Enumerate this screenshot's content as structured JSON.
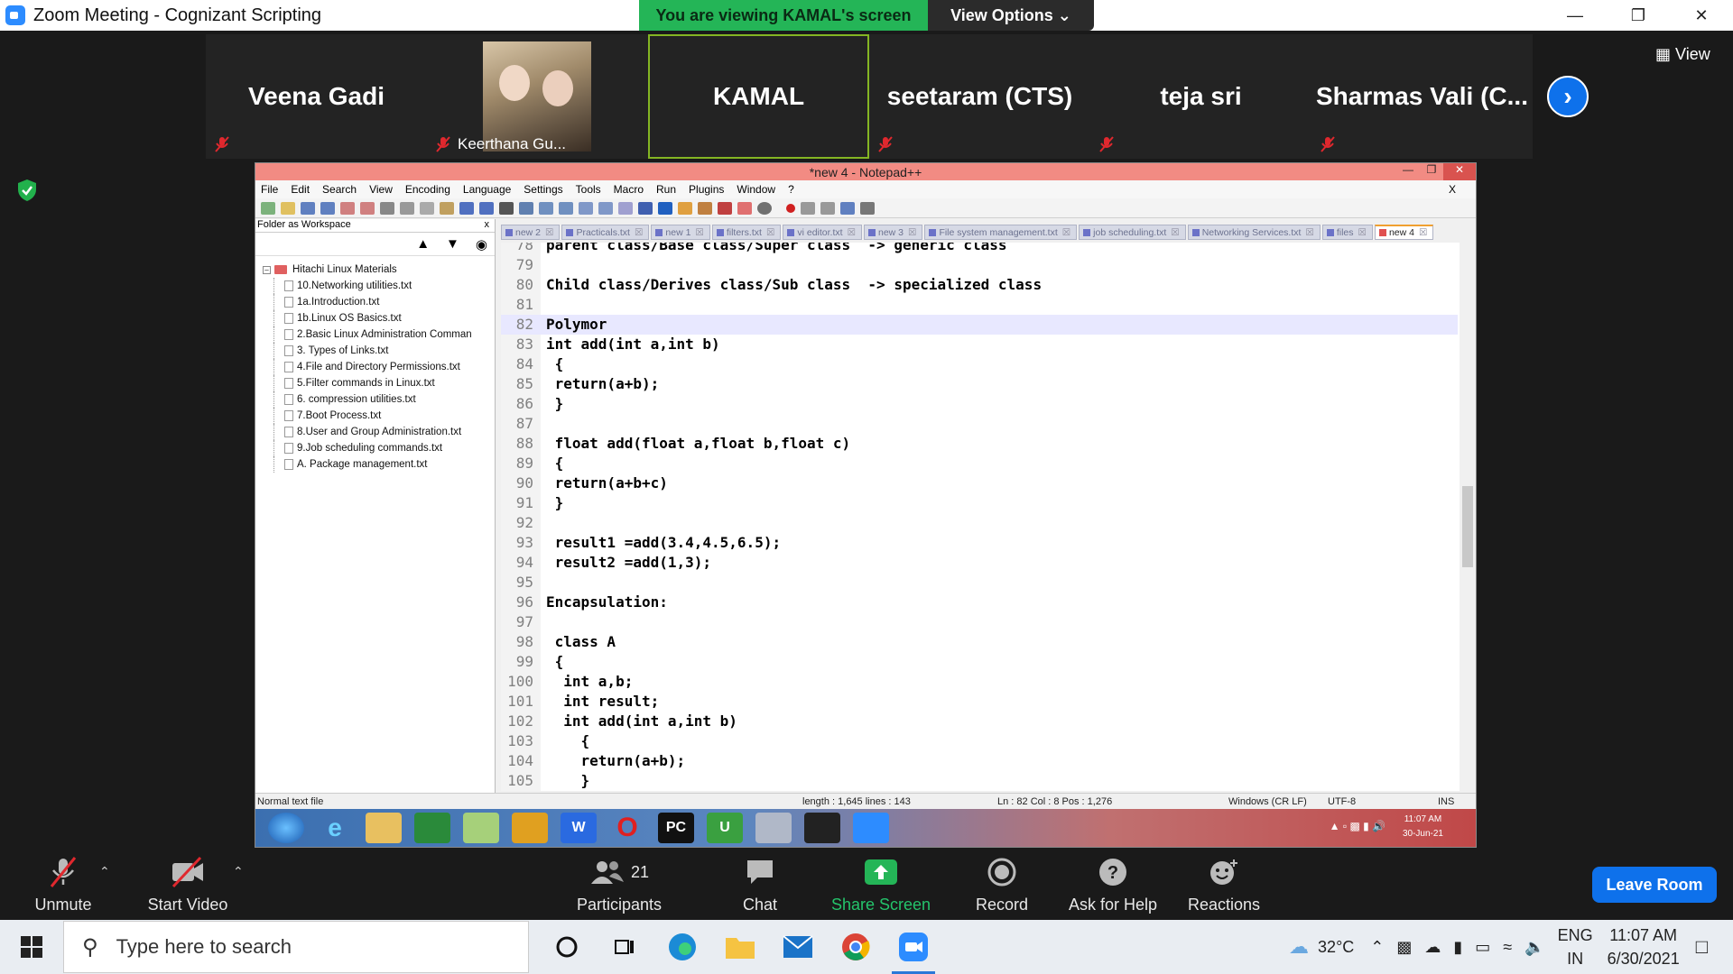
{
  "zoom": {
    "title": "Zoom Meeting - Cognizant Scripting",
    "banner": "You are viewing KAMAL's screen",
    "view_options": "View Options ⌄",
    "view_label": "View",
    "participants": [
      {
        "name": "Veena Gadi"
      },
      {
        "name": "Keerthana Gu..."
      },
      {
        "name": "KAMAL"
      },
      {
        "name": "seetaram (CTS)"
      },
      {
        "name": "teja sri"
      },
      {
        "name": "Sharmas  Vali  (C..."
      }
    ],
    "controls": {
      "unmute": "Unmute",
      "start_video": "Start Video",
      "participants": "Participants",
      "participants_count": "21",
      "chat": "Chat",
      "share_screen": "Share Screen",
      "record": "Record",
      "ask_for_help": "Ask for Help",
      "reactions": "Reactions",
      "leave": "Leave Room"
    }
  },
  "npp": {
    "title": "*new 4 - Notepad++",
    "menu": [
      "File",
      "Edit",
      "Search",
      "View",
      "Encoding",
      "Language",
      "Settings",
      "Tools",
      "Macro",
      "Run",
      "Plugins",
      "Window",
      "?"
    ],
    "menu_close": "X",
    "workspace_title": "Folder as Workspace",
    "workspace_close": "x",
    "tree_root": "Hitachi Linux Materials",
    "tree_files": [
      "10.Networking utilities.txt",
      "1a.Introduction.txt",
      "1b.Linux OS Basics.txt",
      "2.Basic Linux Administration Comman",
      "3. Types of Links.txt",
      "4.File and Directory Permissions.txt",
      "5.Filter commands in Linux.txt",
      "6. compression utilities.txt",
      "7.Boot Process.txt",
      "8.User and Group Administration.txt",
      "9.Job scheduling commands.txt",
      "A. Package management.txt"
    ],
    "tabs": [
      "new 2",
      "Practicals.txt",
      "new 1",
      "filters.txt",
      "vi editor.txt",
      "new 3",
      "File system management.txt",
      "job scheduling.txt",
      "Networking Services.txt",
      "files",
      "new 4"
    ],
    "lines": [
      {
        "n": "78",
        "t": "parent class/Base class/Super class  -> generic class"
      },
      {
        "n": "79",
        "t": ""
      },
      {
        "n": "80",
        "t": "Child class/Derives class/Sub class  -> specialized class"
      },
      {
        "n": "81",
        "t": ""
      },
      {
        "n": "82",
        "t": "Polymor"
      },
      {
        "n": "83",
        "t": "int add(int a,int b)"
      },
      {
        "n": "84",
        "t": " {"
      },
      {
        "n": "85",
        "t": " return(a+b);"
      },
      {
        "n": "86",
        "t": " }"
      },
      {
        "n": "87",
        "t": ""
      },
      {
        "n": "88",
        "t": " float add(float a,float b,float c)"
      },
      {
        "n": "89",
        "t": " {"
      },
      {
        "n": "90",
        "t": " return(a+b+c)"
      },
      {
        "n": "91",
        "t": " }"
      },
      {
        "n": "92",
        "t": ""
      },
      {
        "n": "93",
        "t": " result1 =add(3.4,4.5,6.5);"
      },
      {
        "n": "94",
        "t": " result2 =add(1,3);"
      },
      {
        "n": "95",
        "t": ""
      },
      {
        "n": "96",
        "t": "Encapsulation:"
      },
      {
        "n": "97",
        "t": ""
      },
      {
        "n": "98",
        "t": " class A"
      },
      {
        "n": "99",
        "t": " {"
      },
      {
        "n": "100",
        "t": "  int a,b;"
      },
      {
        "n": "101",
        "t": "  int result;"
      },
      {
        "n": "102",
        "t": "  int add(int a,int b)"
      },
      {
        "n": "103",
        "t": "    {"
      },
      {
        "n": "104",
        "t": "    return(a+b);"
      },
      {
        "n": "105",
        "t": "    }"
      }
    ],
    "status": {
      "type": "Normal text file",
      "length": "length : 1,645    lines : 143",
      "pos": "Ln : 82    Col : 8    Pos : 1,276",
      "eol": "Windows (CR LF)",
      "enc": "UTF-8",
      "mode": "INS"
    },
    "inner_clock_time": "11:07 AM",
    "inner_clock_date": "30-Jun-21"
  },
  "taskbar": {
    "search_placeholder": "Type here to search",
    "temp": "32°C",
    "lang1": "ENG",
    "lang2": "IN",
    "time": "11:07 AM",
    "date": "6/30/2021"
  }
}
